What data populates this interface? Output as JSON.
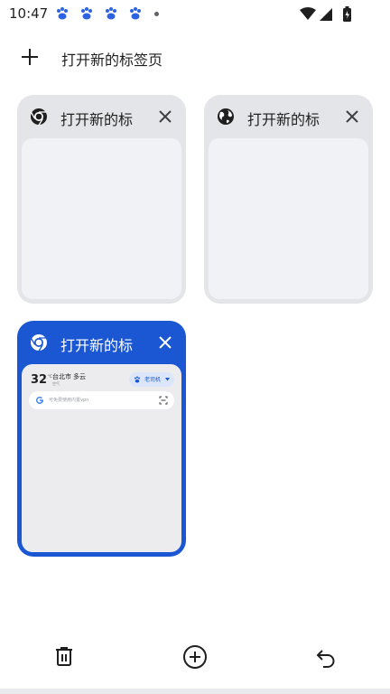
{
  "status_bar": {
    "time": "10:47",
    "notification_icons": [
      "baidu-paw-icon",
      "baidu-paw-icon",
      "baidu-paw-icon",
      "baidu-paw-icon",
      "more-notifications-dot"
    ],
    "system_icons": [
      "wifi-icon",
      "signal-icon",
      "battery-charging-icon"
    ]
  },
  "new_tab": {
    "icon": "plus-icon",
    "label": "打开新的标签页"
  },
  "tabs": [
    {
      "title": "打开新的标",
      "favicon": "chrome-icon",
      "close_icon": "close-icon",
      "selected": false
    },
    {
      "title": "打开新的标",
      "favicon": "globe-icon",
      "close_icon": "close-icon",
      "selected": false
    },
    {
      "title": "打开新的标",
      "favicon": "chrome-icon",
      "close_icon": "close-icon",
      "selected": true
    }
  ],
  "preview": {
    "temperature": "32",
    "temperature_unit": "°C",
    "city": "台北市",
    "weather": "多云",
    "sub_text": "空气",
    "chip_label": "老司机",
    "search_placeholder": "可免费使用内置vpn"
  },
  "toolbar": {
    "left_icon": "trash-icon",
    "center_icon": "add-circle-icon",
    "right_icon": "undo-icon"
  },
  "colors": {
    "active_tab": "#1b57d3",
    "inactive_tab": "#e4e5e9",
    "thumbnail": "#f1f2f6",
    "text": "#1f1f1f"
  }
}
